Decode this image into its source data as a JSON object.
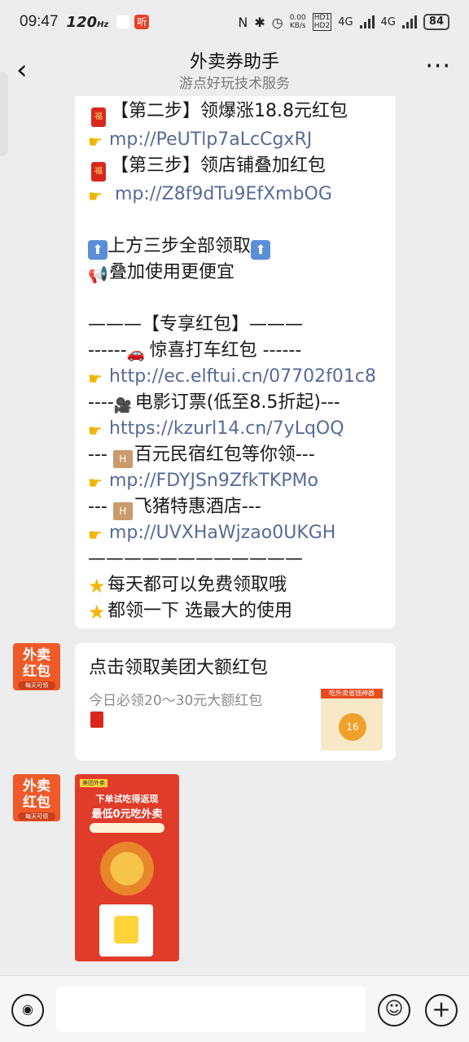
{
  "status_bar": {
    "time": "09:47",
    "network_rate": "120",
    "rate_unit": "Hz",
    "app_icon_text": "听",
    "speed_value": "0.00",
    "speed_unit": "KB/s",
    "hd1": "HD1",
    "hd2": "HD2",
    "net1": "4G",
    "net2": "4G",
    "battery": "84"
  },
  "header": {
    "title": "外卖券助手",
    "subtitle": "游点好玩技术服务"
  },
  "message_text": {
    "step2": "【第二步】领爆涨18.8元红包",
    "link2": "mp://PeUTlp7aLcCgxRJ",
    "step3": "【第三步】领店铺叠加红包",
    "link3": " mp://Z8f9dTu9EfXmbOG",
    "all_three": "上方三步全部领取",
    "stack_use": "叠加使用更便宜",
    "exclusive_header": "———【专享红包】———",
    "taxi_pre": "------",
    "taxi_label": "惊喜打车红包 ------",
    "taxi_link": "http://ec.elftui.cn/07702f01c8",
    "movie_pre": "----",
    "movie_label": "电影订票(低至8.5折起)---",
    "movie_link": "https://kzurl14.cn/7yLqOQ",
    "homestay_pre": "--- ",
    "homestay_label": "百元民宿红包等你领---",
    "homestay_link": "mp://FDYJSn9ZfkTKPMo",
    "fliggy_pre": "--- ",
    "fliggy_label": "飞猪特惠酒店---",
    "fliggy_link": "mp://UVXHaWjzao0UKGH",
    "divider": "————————————",
    "free_daily": "每天都可以免费领取哦",
    "pick_biggest": "都领一下 选最大的使用"
  },
  "avatar": {
    "line1": "外卖",
    "line2": "红包",
    "line3": "每天可领"
  },
  "card": {
    "title": "点击领取美团大额红包",
    "description": "今日必领20～30元大额红包",
    "thumb_band": "吃外卖省钱神器",
    "thumb_value": "16"
  },
  "poster": {
    "tag": "美团外卖",
    "headline1": "下单试吃得返现",
    "headline2": "最低0元吃外卖"
  },
  "input_bar": {
    "placeholder": ""
  },
  "icons": {
    "back": "back-chevron-icon",
    "more": "more-dots-icon",
    "voice": "voice-icon",
    "emoji": "emoji-icon",
    "plus": "plus-icon",
    "red_envelope": "red-envelope-icon",
    "pointing_hand": "pointing-hand-icon",
    "up_arrow": "up-arrow-icon",
    "megaphone": "megaphone-icon",
    "car": "car-icon",
    "film_camera": "film-camera-icon",
    "hotel": "hotel-icon",
    "star": "star-icon"
  }
}
